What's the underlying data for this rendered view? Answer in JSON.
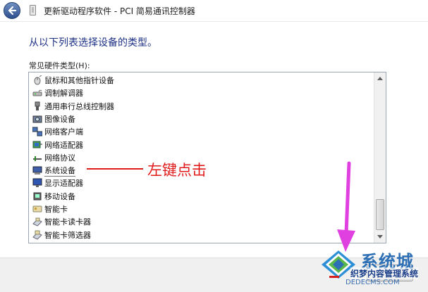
{
  "window": {
    "title": "更新驱动程序软件 - PCI 简易通讯控制器"
  },
  "main": {
    "heading": "从以下列表选择设备的类型。",
    "list_label": "常见硬件类型(H):",
    "items": [
      {
        "label": "鼠标和其他指针设备",
        "icon": "mouse-icon"
      },
      {
        "label": "调制解调器",
        "icon": "modem-icon"
      },
      {
        "label": "通用串行总线控制器",
        "icon": "usb-icon"
      },
      {
        "label": "图像设备",
        "icon": "camera-icon"
      },
      {
        "label": "网络客户端",
        "icon": "network-client-icon"
      },
      {
        "label": "网络适配器",
        "icon": "network-adapter-icon"
      },
      {
        "label": "网络协议",
        "icon": "network-protocol-icon"
      },
      {
        "label": "系统设备",
        "icon": "system-device-icon"
      },
      {
        "label": "显示适配器",
        "icon": "monitor-icon"
      },
      {
        "label": "移动设备",
        "icon": "mobile-device-icon"
      },
      {
        "label": "智能卡",
        "icon": "smart-card-icon"
      },
      {
        "label": "智能卡读卡器",
        "icon": "card-reader-icon"
      },
      {
        "label": "智能卡筛选器",
        "icon": "card-filter-icon"
      }
    ],
    "selected_index": 7
  },
  "annotation": {
    "text": "左键点击",
    "color": "#e11a1a",
    "arrow_color": "#e040e0"
  },
  "watermark": {
    "title": "系统城",
    "subtitle": "织梦内容管理系统",
    "url": "DEDECMS.COM"
  },
  "colors": {
    "heading": "#1e3287",
    "accent": "#2d6fb5"
  }
}
